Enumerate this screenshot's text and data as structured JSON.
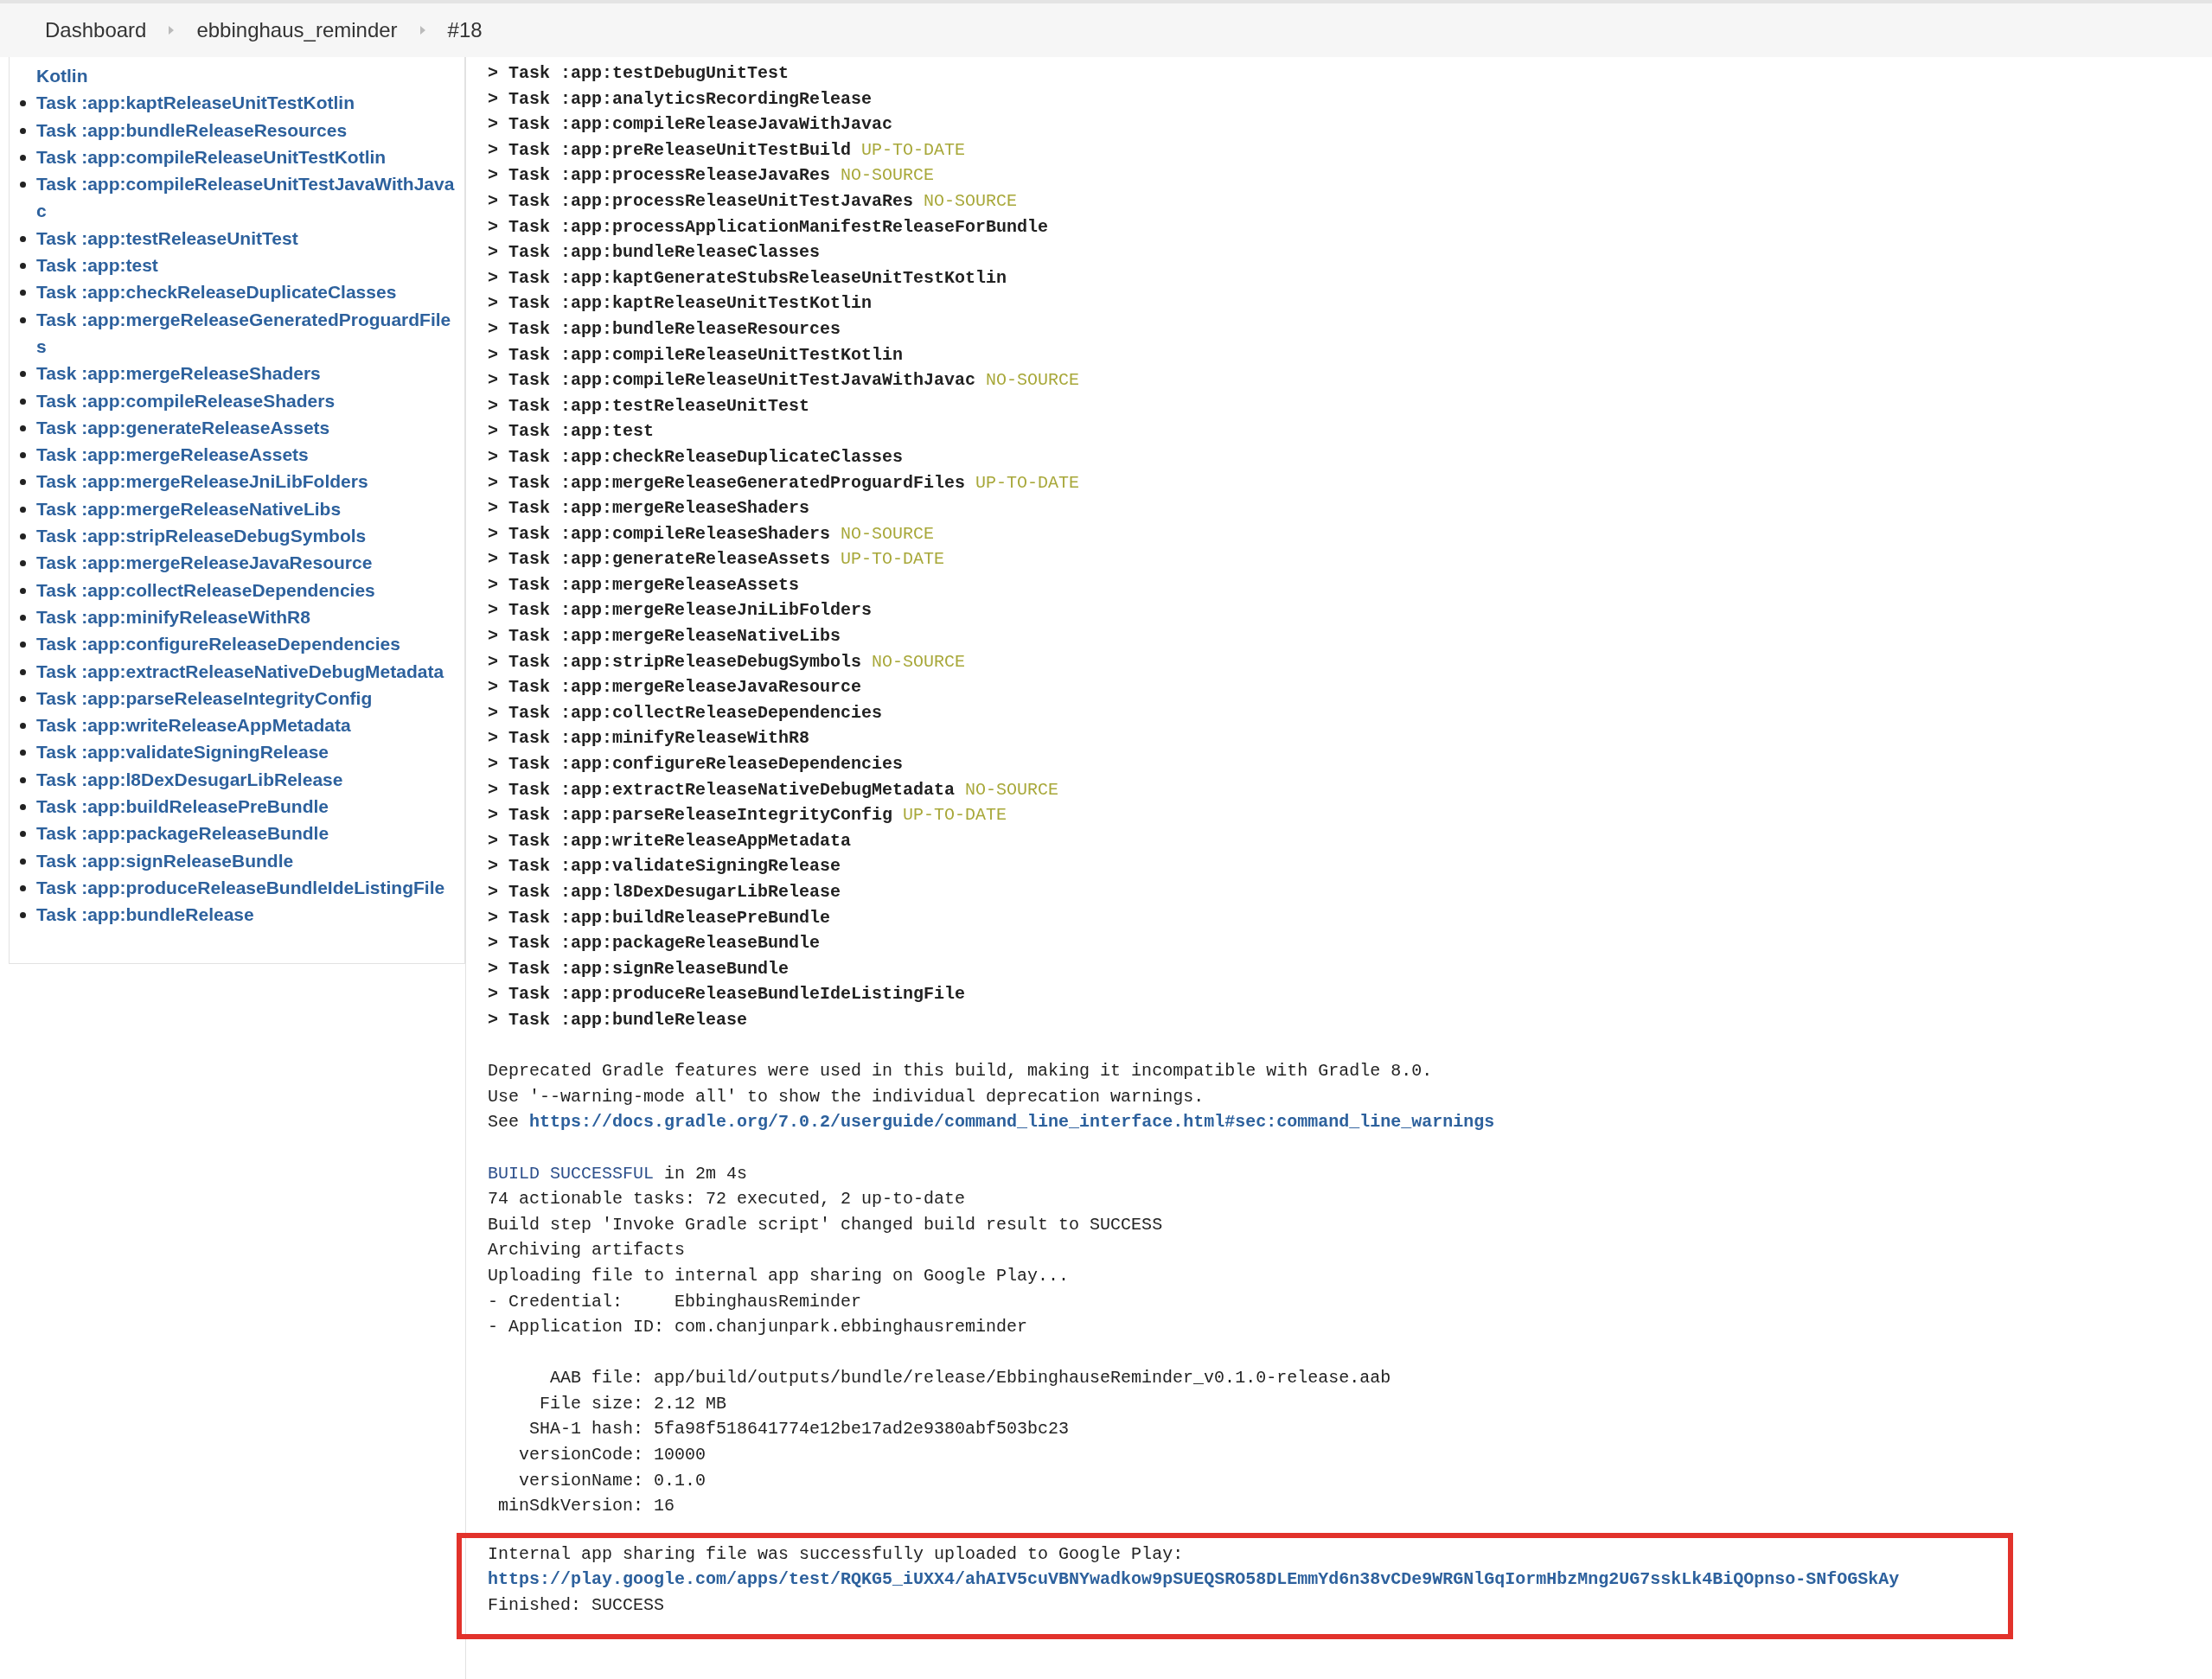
{
  "breadcrumbs": [
    {
      "label": "Dashboard"
    },
    {
      "label": "ebbinghaus_reminder"
    },
    {
      "label": "#18"
    }
  ],
  "sidebar": {
    "items": [
      {
        "kind": "continuation",
        "label": "Kotlin"
      },
      {
        "kind": "item",
        "label": "Task :app:kaptReleaseUnitTestKotlin"
      },
      {
        "kind": "item",
        "label": "Task :app:bundleReleaseResources"
      },
      {
        "kind": "item",
        "label": "Task :app:compileReleaseUnitTestKotlin"
      },
      {
        "kind": "item",
        "label": "Task :app:compileReleaseUnitTestJavaWithJavac"
      },
      {
        "kind": "item",
        "label": "Task :app:testReleaseUnitTest"
      },
      {
        "kind": "item",
        "label": "Task :app:test"
      },
      {
        "kind": "item",
        "label": "Task :app:checkReleaseDuplicateClasses"
      },
      {
        "kind": "item",
        "label": "Task :app:mergeReleaseGeneratedProguardFiles"
      },
      {
        "kind": "item",
        "label": "Task :app:mergeReleaseShaders"
      },
      {
        "kind": "item",
        "label": "Task :app:compileReleaseShaders"
      },
      {
        "kind": "item",
        "label": "Task :app:generateReleaseAssets"
      },
      {
        "kind": "item",
        "label": "Task :app:mergeReleaseAssets"
      },
      {
        "kind": "item",
        "label": "Task :app:mergeReleaseJniLibFolders"
      },
      {
        "kind": "item",
        "label": "Task :app:mergeReleaseNativeLibs"
      },
      {
        "kind": "item",
        "label": "Task :app:stripReleaseDebugSymbols"
      },
      {
        "kind": "item",
        "label": "Task :app:mergeReleaseJavaResource"
      },
      {
        "kind": "item",
        "label": "Task :app:collectReleaseDependencies"
      },
      {
        "kind": "item",
        "label": "Task :app:minifyReleaseWithR8"
      },
      {
        "kind": "item",
        "label": "Task :app:configureReleaseDependencies"
      },
      {
        "kind": "item",
        "label": "Task :app:extractReleaseNativeDebugMetadata"
      },
      {
        "kind": "item",
        "label": "Task :app:parseReleaseIntegrityConfig"
      },
      {
        "kind": "item",
        "label": "Task :app:writeReleaseAppMetadata"
      },
      {
        "kind": "item",
        "label": "Task :app:validateSigningRelease"
      },
      {
        "kind": "item",
        "label": "Task :app:l8DexDesugarLibRelease"
      },
      {
        "kind": "item",
        "label": "Task :app:buildReleasePreBundle"
      },
      {
        "kind": "item",
        "label": "Task :app:packageReleaseBundle"
      },
      {
        "kind": "item",
        "label": "Task :app:signReleaseBundle"
      },
      {
        "kind": "item",
        "label": "Task :app:produceReleaseBundleIdeListingFile"
      },
      {
        "kind": "item",
        "label": "Task :app:bundleRelease"
      }
    ]
  },
  "console": {
    "lines": [
      {
        "kind": "task",
        "text": "> Task :app:testDebugUnitTest"
      },
      {
        "kind": "task",
        "text": "> Task :app:analyticsRecordingRelease"
      },
      {
        "kind": "task",
        "text": "> Task :app:compileReleaseJavaWithJavac"
      },
      {
        "kind": "task",
        "text": "> Task :app:preReleaseUnitTestBuild",
        "status": "UP-TO-DATE"
      },
      {
        "kind": "task",
        "text": "> Task :app:processReleaseJavaRes",
        "status": "NO-SOURCE"
      },
      {
        "kind": "task",
        "text": "> Task :app:processReleaseUnitTestJavaRes",
        "status": "NO-SOURCE"
      },
      {
        "kind": "task",
        "text": "> Task :app:processApplicationManifestReleaseForBundle"
      },
      {
        "kind": "task",
        "text": "> Task :app:bundleReleaseClasses"
      },
      {
        "kind": "task",
        "text": "> Task :app:kaptGenerateStubsReleaseUnitTestKotlin"
      },
      {
        "kind": "task",
        "text": "> Task :app:kaptReleaseUnitTestKotlin"
      },
      {
        "kind": "task",
        "text": "> Task :app:bundleReleaseResources"
      },
      {
        "kind": "task",
        "text": "> Task :app:compileReleaseUnitTestKotlin"
      },
      {
        "kind": "task",
        "text": "> Task :app:compileReleaseUnitTestJavaWithJavac",
        "status": "NO-SOURCE"
      },
      {
        "kind": "task",
        "text": "> Task :app:testReleaseUnitTest"
      },
      {
        "kind": "task",
        "text": "> Task :app:test"
      },
      {
        "kind": "task",
        "text": "> Task :app:checkReleaseDuplicateClasses"
      },
      {
        "kind": "task",
        "text": "> Task :app:mergeReleaseGeneratedProguardFiles",
        "status": "UP-TO-DATE"
      },
      {
        "kind": "task",
        "text": "> Task :app:mergeReleaseShaders"
      },
      {
        "kind": "task",
        "text": "> Task :app:compileReleaseShaders",
        "status": "NO-SOURCE"
      },
      {
        "kind": "task",
        "text": "> Task :app:generateReleaseAssets",
        "status": "UP-TO-DATE"
      },
      {
        "kind": "task",
        "text": "> Task :app:mergeReleaseAssets"
      },
      {
        "kind": "task",
        "text": "> Task :app:mergeReleaseJniLibFolders"
      },
      {
        "kind": "task",
        "text": "> Task :app:mergeReleaseNativeLibs"
      },
      {
        "kind": "task",
        "text": "> Task :app:stripReleaseDebugSymbols",
        "status": "NO-SOURCE"
      },
      {
        "kind": "task",
        "text": "> Task :app:mergeReleaseJavaResource"
      },
      {
        "kind": "task",
        "text": "> Task :app:collectReleaseDependencies"
      },
      {
        "kind": "task",
        "text": "> Task :app:minifyReleaseWithR8"
      },
      {
        "kind": "task",
        "text": "> Task :app:configureReleaseDependencies"
      },
      {
        "kind": "task",
        "text": "> Task :app:extractReleaseNativeDebugMetadata",
        "status": "NO-SOURCE"
      },
      {
        "kind": "task",
        "text": "> Task :app:parseReleaseIntegrityConfig",
        "status": "UP-TO-DATE"
      },
      {
        "kind": "task",
        "text": "> Task :app:writeReleaseAppMetadata"
      },
      {
        "kind": "task",
        "text": "> Task :app:validateSigningRelease"
      },
      {
        "kind": "task",
        "text": "> Task :app:l8DexDesugarLibRelease"
      },
      {
        "kind": "task",
        "text": "> Task :app:buildReleasePreBundle"
      },
      {
        "kind": "task",
        "text": "> Task :app:packageReleaseBundle"
      },
      {
        "kind": "task",
        "text": "> Task :app:signReleaseBundle"
      },
      {
        "kind": "task",
        "text": "> Task :app:produceReleaseBundleIdeListingFile"
      },
      {
        "kind": "task",
        "text": "> Task :app:bundleRelease"
      },
      {
        "kind": "blank"
      },
      {
        "kind": "text",
        "text": "Deprecated Gradle features were used in this build, making it incompatible with Gradle 8.0."
      },
      {
        "kind": "text",
        "text": "Use '--warning-mode all' to show the individual deprecation warnings."
      },
      {
        "kind": "link",
        "text": "See",
        "url": "https://docs.gradle.org/7.0.2/userguide/command_line_interface.html#sec:command_line_warnings"
      },
      {
        "kind": "blank"
      },
      {
        "kind": "result",
        "status": "BUILD SUCCESSFUL",
        "text": "in 2m 4s"
      },
      {
        "kind": "text",
        "text": "74 actionable tasks: 72 executed, 2 up-to-date"
      },
      {
        "kind": "text",
        "text": "Build step 'Invoke Gradle script' changed build result to SUCCESS"
      },
      {
        "kind": "text",
        "text": "Archiving artifacts"
      },
      {
        "kind": "text",
        "text": "Uploading file to internal app sharing on Google Play..."
      },
      {
        "kind": "text",
        "text": "- Credential:     EbbinghausReminder"
      },
      {
        "kind": "text",
        "text": "- Application ID: com.chanjunpark.ebbinghausreminder"
      },
      {
        "kind": "blank"
      },
      {
        "kind": "field",
        "label": "AAB file:",
        "value": "app/build/outputs/bundle/release/EbbinghauseReminder_v0.1.0-release.aab"
      },
      {
        "kind": "field",
        "label": "File size:",
        "value": "2.12 MB"
      },
      {
        "kind": "field",
        "label": "SHA-1 hash:",
        "value": "5fa98f518641774e12be17ad2e9380abf503bc23"
      },
      {
        "kind": "field",
        "label": "versionCode:",
        "value": "10000"
      },
      {
        "kind": "field",
        "label": "versionName:",
        "value": "0.1.0"
      },
      {
        "kind": "field",
        "label": "minSdkVersion:",
        "value": "16"
      }
    ]
  },
  "highlight": {
    "lines": [
      {
        "kind": "text",
        "text": "Internal app sharing file was successfully uploaded to Google Play:"
      },
      {
        "kind": "url",
        "url": "https://play.google.com/apps/test/RQKG5_iUXX4/ahAIV5cuVBNYwadkow9pSUEQSRO58DLEmmYd6n38vCDe9WRGNlGqIormHbzMng2UG7sskLk4BiQOpnso-SNfOGSkAy"
      },
      {
        "kind": "text",
        "text": "Finished: SUCCESS"
      }
    ]
  }
}
